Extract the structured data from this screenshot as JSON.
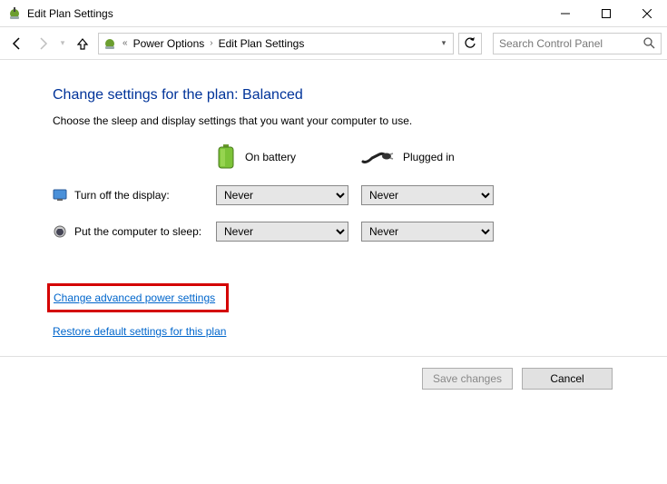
{
  "window": {
    "title": "Edit Plan Settings"
  },
  "breadcrumb": {
    "item1": "Power Options",
    "item2": "Edit Plan Settings"
  },
  "search": {
    "placeholder": "Search Control Panel"
  },
  "page": {
    "heading": "Change settings for the plan: Balanced",
    "subtitle": "Choose the sleep and display settings that you want your computer to use."
  },
  "columns": {
    "battery": "On battery",
    "plugged": "Plugged in"
  },
  "settings": {
    "display_label": "Turn off the display:",
    "sleep_label": "Put the computer to sleep:",
    "display_battery": "Never",
    "display_plugged": "Never",
    "sleep_battery": "Never",
    "sleep_plugged": "Never"
  },
  "links": {
    "advanced": "Change advanced power settings",
    "restore": "Restore default settings for this plan"
  },
  "buttons": {
    "save": "Save changes",
    "cancel": "Cancel"
  }
}
